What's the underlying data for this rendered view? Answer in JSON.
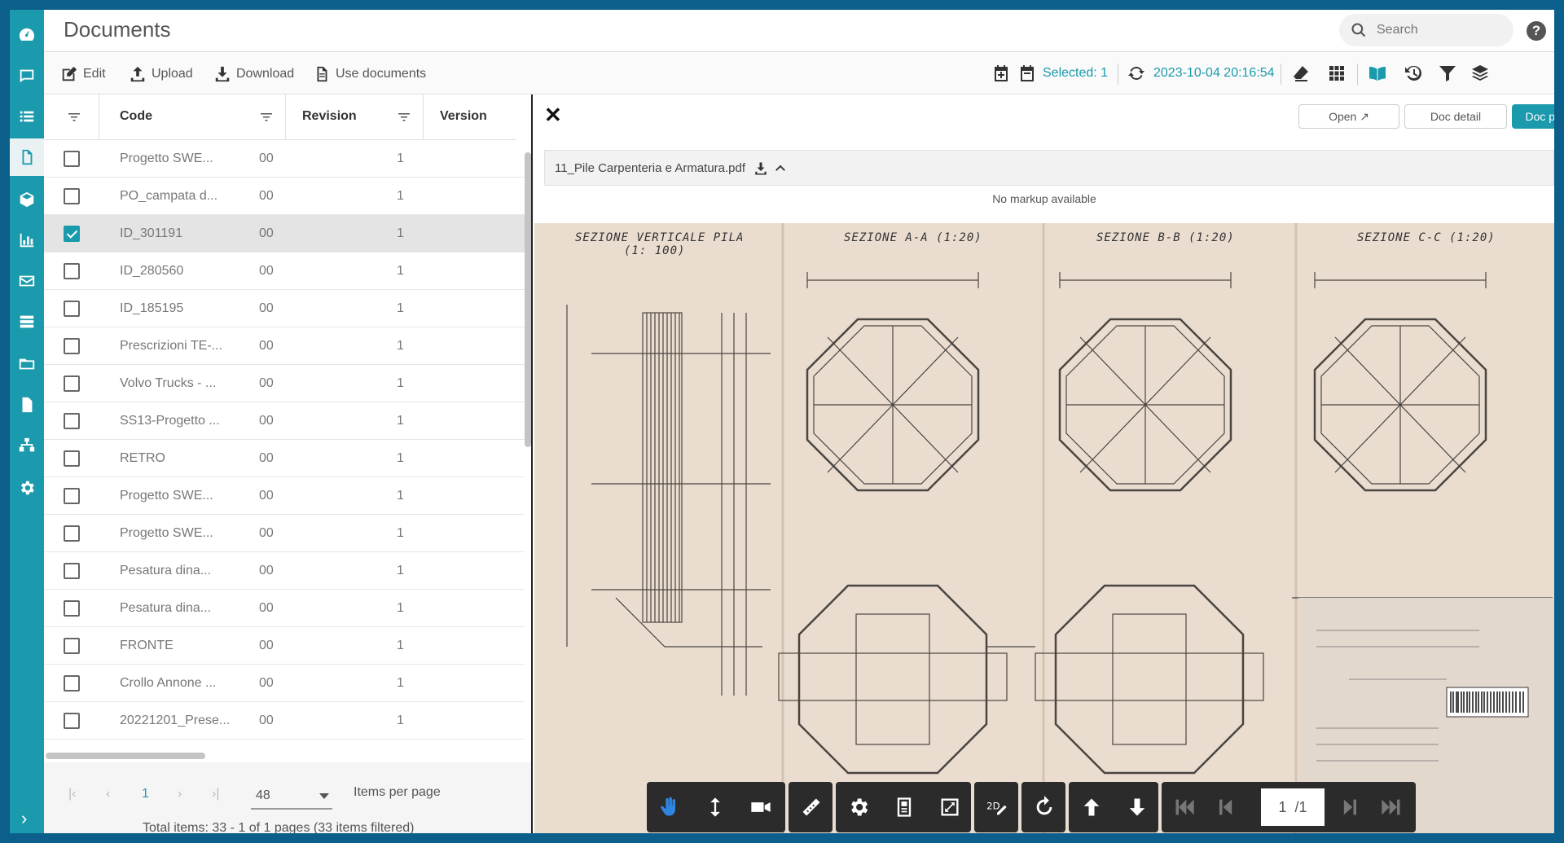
{
  "header": {
    "title": "Documents",
    "search_placeholder": "Search",
    "help": "?"
  },
  "sidebar": {
    "items": [
      {
        "icon": "dashboard-icon"
      },
      {
        "icon": "chat-icon"
      },
      {
        "icon": "list-icon"
      },
      {
        "icon": "document-icon",
        "active": true
      },
      {
        "icon": "cube-icon"
      },
      {
        "icon": "chart-icon"
      },
      {
        "icon": "mail-icon"
      },
      {
        "icon": "stack-icon"
      },
      {
        "icon": "folder-icon"
      },
      {
        "icon": "file-icon"
      },
      {
        "icon": "org-chart-icon"
      },
      {
        "icon": "gear-icon"
      }
    ],
    "expand": "›"
  },
  "toolbar": {
    "edit": "Edit",
    "upload": "Upload",
    "download": "Download",
    "use_documents": "Use documents",
    "selected": "Selected: 1",
    "timestamp": "2023-10-04 20:16:54"
  },
  "grid": {
    "columns": {
      "code": "Code",
      "revision": "Revision",
      "version": "Version"
    },
    "rows": [
      {
        "code": "Progetto SWE...",
        "revision": "00",
        "version": "1",
        "checked": false
      },
      {
        "code": "PO_campata d...",
        "revision": "00",
        "version": "1",
        "checked": false
      },
      {
        "code": "ID_301191",
        "revision": "00",
        "version": "1",
        "checked": true
      },
      {
        "code": "ID_280560",
        "revision": "00",
        "version": "1",
        "checked": false
      },
      {
        "code": "ID_185195",
        "revision": "00",
        "version": "1",
        "checked": false
      },
      {
        "code": "Prescrizioni TE-...",
        "revision": "00",
        "version": "1",
        "checked": false
      },
      {
        "code": "Volvo Trucks - ...",
        "revision": "00",
        "version": "1",
        "checked": false
      },
      {
        "code": "SS13-Progetto ...",
        "revision": "00",
        "version": "1",
        "checked": false
      },
      {
        "code": "RETRO",
        "revision": "00",
        "version": "1",
        "checked": false
      },
      {
        "code": "Progetto SWE...",
        "revision": "00",
        "version": "1",
        "checked": false
      },
      {
        "code": "Progetto SWE...",
        "revision": "00",
        "version": "1",
        "checked": false
      },
      {
        "code": "Pesatura dina...",
        "revision": "00",
        "version": "1",
        "checked": false
      },
      {
        "code": "Pesatura dina...",
        "revision": "00",
        "version": "1",
        "checked": false
      },
      {
        "code": "FRONTE",
        "revision": "00",
        "version": "1",
        "checked": false
      },
      {
        "code": "Crollo Annone ...",
        "revision": "00",
        "version": "1",
        "checked": false
      },
      {
        "code": "20221201_Prese...",
        "revision": "00",
        "version": "1",
        "checked": false
      }
    ]
  },
  "pager": {
    "first": "|‹",
    "prev": "‹",
    "current": "1",
    "next": "›",
    "last": "›|",
    "page_size": "48",
    "items_per_page": "Items per page",
    "total": "Total items: 33 - 1 of 1 pages (33 items filtered)"
  },
  "viewer": {
    "close": "✕",
    "open": "Open",
    "doc_detail": "Doc detail",
    "doc_preview": "Doc preview",
    "file_name": "11_Pile Carpenteria e Armatura.pdf",
    "no_markup": "No markup available",
    "drawing_titles": [
      "SEZIONE  VERTICALE  PILA",
      "(1: 100)",
      "SEZIONE   A-A   (1:20)",
      "SEZIONE   B-B (1:20)",
      "SEZIONE   C-C   (1:20)"
    ],
    "page_current": "1",
    "page_total": "/1"
  }
}
